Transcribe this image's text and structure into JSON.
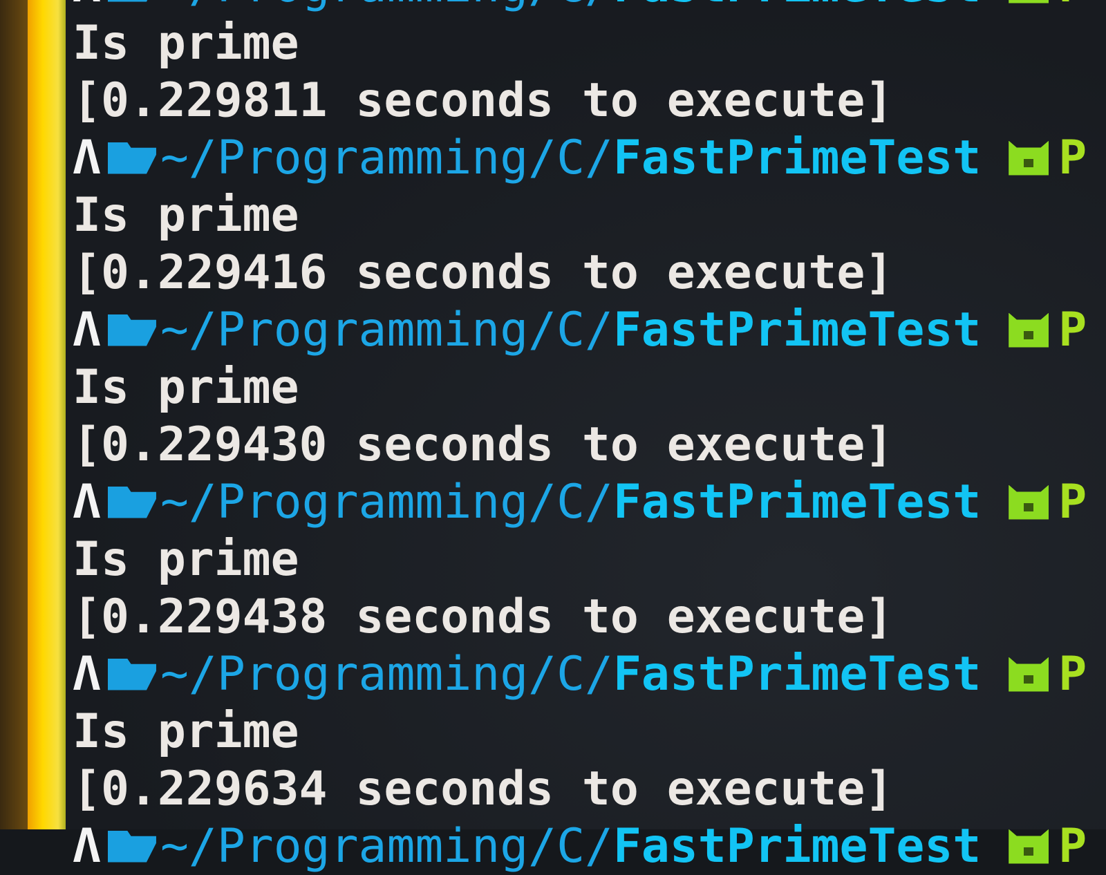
{
  "terminal": {
    "prompt": {
      "path_prefix": "~/Programming/C/",
      "directory": "FastPrimeTest",
      "branch_glyph": "P"
    },
    "runs": [
      {
        "output": "Is prime",
        "timing": "[0.229811 seconds to execute]"
      },
      {
        "output": "Is prime",
        "timing": "[0.229416 seconds to execute]"
      },
      {
        "output": "Is prime",
        "timing": "[0.229430 seconds to execute]"
      },
      {
        "output": "Is prime",
        "timing": "[0.229438 seconds to execute]"
      },
      {
        "output": "Is prime",
        "timing": "[0.229634 seconds to execute]"
      }
    ],
    "colors": {
      "background": "#15181c",
      "path": "#1ca6e6",
      "directory": "#12c4f4",
      "git": "#8cdc20",
      "text": "#ece8e4",
      "side_strip": "#ffd800"
    }
  }
}
